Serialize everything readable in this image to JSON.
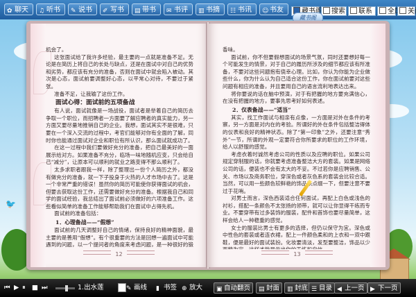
{
  "toolbar": {
    "buttons": [
      {
        "label": "聊天",
        "icon": "chat-icon",
        "glyph": "✿"
      },
      {
        "label": "听书",
        "icon": "headphones-icon",
        "glyph": "♫"
      },
      {
        "label": "说书",
        "icon": "microphone-icon",
        "glyph": "✎"
      },
      {
        "label": "写书",
        "icon": "pen-icon",
        "glyph": "✐"
      },
      {
        "label": "带书",
        "icon": "book-carry-icon",
        "glyph": "▤"
      },
      {
        "label": "书评",
        "icon": "comment-icon",
        "glyph": "✉"
      },
      {
        "label": "书摘",
        "icon": "excerpt-icon",
        "glyph": "▥"
      },
      {
        "label": "书讯",
        "icon": "news-icon",
        "glyph": "☷"
      },
      {
        "label": "书友",
        "icon": "friends-icon",
        "glyph": "☺"
      }
    ],
    "right": [
      {
        "label": "藏书阁",
        "checked": true
      },
      {
        "label": "搜索",
        "checked": false
      },
      {
        "label": "联系",
        "checked": false
      },
      {
        "label": "全屏",
        "checked": false
      },
      {
        "label": "关闭",
        "checked": false
      }
    ]
  },
  "left_page": {
    "paragraphs": [
      {
        "type": "p",
        "noind": true,
        "text": "机会了。"
      },
      {
        "type": "p",
        "text": "这张面试给了我许多经验，最主要的一点就是准备不足。无论是在简历上将自己的长处与缺点，还是在面试中对自己的优势和劣势，都应该有充分的准备，否则在面试中就会陷入被动。其次是心态，面试前要调整好心态，以平常心对待，不要过于紧张。"
      },
      {
        "type": "p",
        "text": "准备不足，让我输了这份工作。"
      },
      {
        "type": "h3",
        "text": "面试心得：面试前的五项备战"
      },
      {
        "type": "p",
        "text": "有人说，面试就像是一场战役，面试者是举着自己的简历去争取一个职位，而招聘者一方面要了解应聘者的真实能力，另一方面又要尽量地推销自己的企业。我想，面试其实不是很难，只要在一个深入交流的过程中，考官们能够对你有全面的了解，同时你也能通过面试对企业和职位有所认识，那么面试就成功了。"
      },
      {
        "type": "p",
        "text": "在这一过程中我们要做好充分的准备，把自己最美好的一面展示给对方。如果准备不充分，临场一味地随机应变，只会给自己“减分”，让原本可以顺利的就业之路变得不那么顺利了。"
      },
      {
        "type": "p",
        "text": "太多求职者跟我一样，除了整理出一份个人简历之外，都没有做充分的准备，就一下子投身于火热的人才市场中去了。这是一个非常严重的错误！虽然你的简历可能使你获得面试的机会，但要去获取这份工作，还需要做好充分的准备。根据我自己和同学的面试经验，我总结出了面试前必须做好的六项准备工作。这些看似简单的准备工作能够帮助我们在面试中占得先机。"
      },
      {
        "type": "p",
        "text": "面试前的准备包括："
      },
      {
        "type": "h4",
        "text": "1．心理备战——“假想”"
      },
      {
        "type": "p",
        "text": "面试前的几天调整好自己的情绪，保持良好的精神面貌，最主要的是善用“假想”。有个很重要的方法是回想一遍面试中可能遇到的问题，以一个提问者的角度来考虑问题，是一种很好的锻炼。例如，你可以提前设想一下面试官可能会问的问题，比如薪资要求、职业规划等等，并提前准备好答案。"
      }
    ],
    "page_number": "12"
  },
  "right_page": {
    "paragraphs": [
      {
        "type": "p",
        "noind": true,
        "text": "香味。"
      },
      {
        "type": "p",
        "text": "面试前，你不但要假想面试的场景气氛，同时还要想好每一个可能发生的情景，对于自己的履历所涉及的细节都应该有所准备，不要对这些问题抱有侥幸心理。比如，你认为你能为企业做些什么，你为什么认为自己适合这份工作，你在面试前要对这些问题有相应的准备，并且要用自己的语言流利地表达出来。"
      },
      {
        "type": "p",
        "text": "将你要说的话在脑中预演，对于有把握的地方要充满信心，在没有把握的地方，要事先思考好如何表述。"
      },
      {
        "type": "h4",
        "text": "2．仪表备战——“适当”"
      },
      {
        "type": "p",
        "text": "其实，找工作面试与相亲有点像，一方面是对外在条件的考察，另一方面是对内在的考验。所谓好的外在条件包括整洁得体的仪表和良好的精神状态。除了“第一印象”之外，还要注意“秀外”一节，所谓的外观一定要符合你所要求的职位的工作环境，给人以舒服的感觉。"
      },
      {
        "type": "p",
        "text": "考虑衣着时诚然考虑公司的性质以及应聘的职位。如果公司规定穿制服的话，你就要考虑准备整洁大方的套装。如果是网络公司的话，便装也不会有太大的不妥。不过若你是应聘销售、公关、市场以及商务职位，穿深色或者灰色系的套装会比较合适。当然，可以用一些颜色较鲜艳的饰品来点缀一下，但要注意不要过于花哨。"
      },
      {
        "type": "p",
        "text": "对男士而言，深色西装适合任何面试，再配上白色或浅色的衬衫，搭配一条颜色不太张扬的领带，就可以让你显得干练而专业。不要穿带有过多装饰的服装，配件和首饰也要尽量简单，这样会给人一种稳重的感觉。"
      },
      {
        "type": "p",
        "text": "女士的服装比男士有更多的选择，但仍以保守为宜。深色或中性色的套装或者连衣裙，配上一件颜色柔和的上衣和一双中跟鞋，便是最好的面试装扮。化妆要清淡，发型要整洁，饰品以少而精为宜，这样才能显示出你的干练和自信。"
      }
    ],
    "page_number": "13"
  },
  "badge": "藏书阁",
  "bottom": {
    "song": "1.出水莲",
    "buttons": [
      {
        "label": "画线",
        "icon": "draw-line-icon",
        "glyph": "✎",
        "boxed": false
      },
      {
        "label": "书签",
        "icon": "bookmark-icon",
        "glyph": "▮",
        "boxed": false
      },
      {
        "label": "放大",
        "icon": "zoom-in-icon",
        "glyph": "⊕",
        "boxed": false
      },
      {
        "label": "自动翻页",
        "icon": "auto-flip-icon",
        "glyph": "▣",
        "boxed": true
      },
      {
        "label": "封面",
        "icon": "cover-icon",
        "glyph": "▤",
        "boxed": true
      },
      {
        "label": "封底",
        "icon": "back-cover-icon",
        "glyph": "▥",
        "boxed": true
      },
      {
        "label": "目录",
        "icon": "toc-icon",
        "glyph": "☰",
        "boxed": true
      },
      {
        "label": "上一页",
        "icon": "prev-page-icon",
        "glyph": "◀",
        "boxed": true
      },
      {
        "label": "下一页",
        "icon": "next-page-icon",
        "glyph": "▶",
        "boxed": true
      }
    ]
  }
}
